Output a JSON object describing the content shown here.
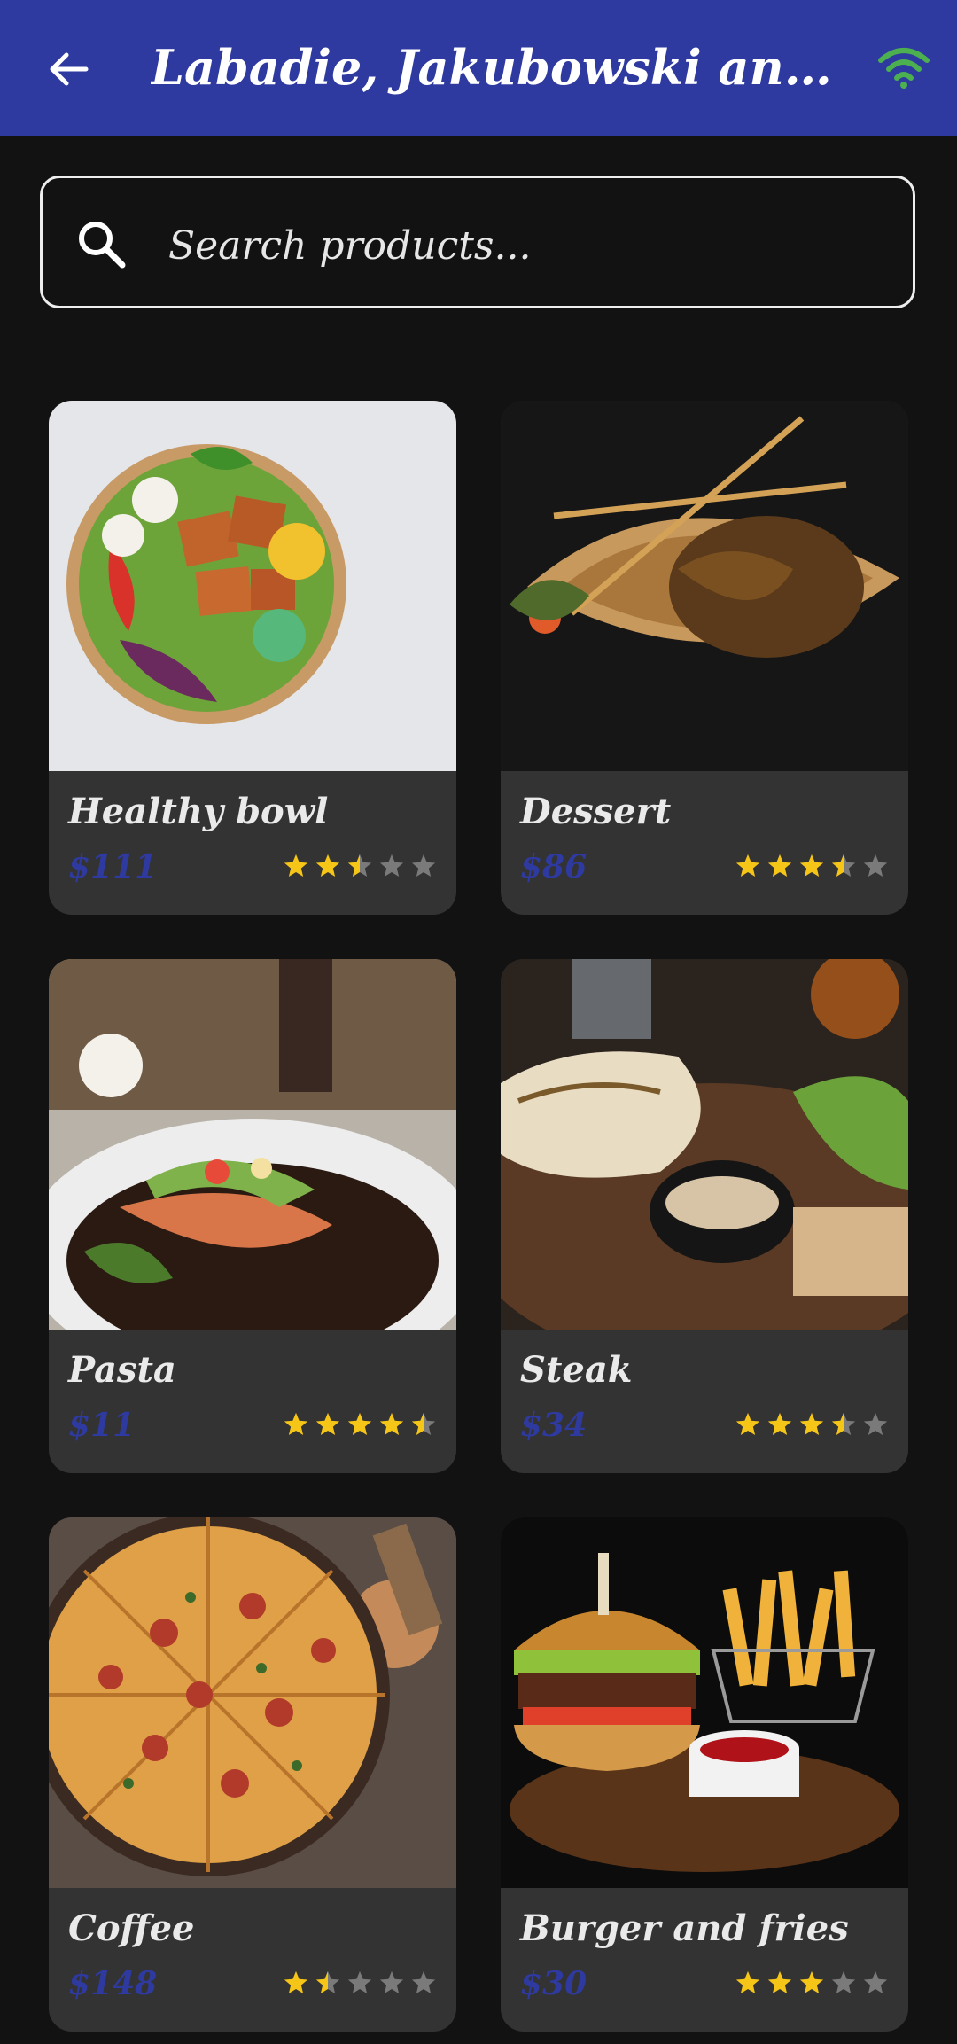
{
  "appbar": {
    "title": "Labadie, Jakubowski and...",
    "back_icon": "arrow-left-icon",
    "status_icon": "wifi-icon",
    "accent": "#2e3a9f",
    "status_color": "#4caf50"
  },
  "search": {
    "placeholder": "Search products...",
    "value": "",
    "icon": "search-icon"
  },
  "products": [
    {
      "name": "Healthy bowl",
      "price": "$111",
      "rating": 2.5
    },
    {
      "name": "Dessert",
      "price": "$86",
      "rating": 3.5
    },
    {
      "name": "Pasta",
      "price": "$11",
      "rating": 4.5
    },
    {
      "name": "Steak",
      "price": "$34",
      "rating": 3.5
    },
    {
      "name": "Coffee",
      "price": "$148",
      "rating": 1.5
    },
    {
      "name": "Burger and fries",
      "price": "$30",
      "rating": 3
    }
  ],
  "colors": {
    "background": "#121212",
    "card": "#333333",
    "star_filled": "#f5c518",
    "star_empty": "#7a7a7a"
  }
}
